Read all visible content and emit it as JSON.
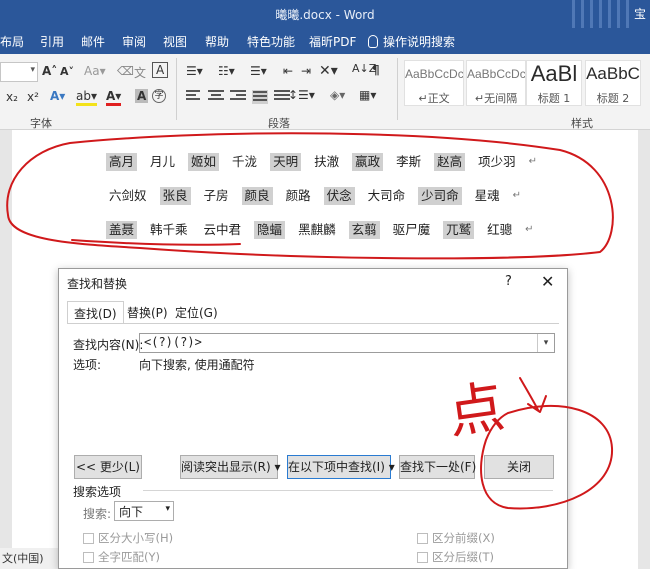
{
  "window": {
    "title": "曦曦.docx - Word",
    "right_text": "宝"
  },
  "tabs": [
    "布局",
    "引用",
    "邮件",
    "审阅",
    "视图",
    "帮助",
    "特色功能",
    "福昕PDF",
    "操作说明搜索"
  ],
  "ribbon": {
    "groups": {
      "font": "字体",
      "paragraph": "段落",
      "styles": "样式"
    },
    "styles": [
      {
        "sample": "AaBbCcDc",
        "name": "正文"
      },
      {
        "sample": "AaBbCcDc",
        "name": "无间隔"
      },
      {
        "sample": "AaBl",
        "name": "标题 1"
      },
      {
        "sample": "AaBbC",
        "name": "标题 2"
      }
    ]
  },
  "document": {
    "lines": [
      [
        "高月",
        "月儿",
        "姬如",
        "千泷",
        "天明",
        "扶澈",
        "嬴政",
        "李斯",
        "赵高",
        "项少羽"
      ],
      [
        "六剑奴",
        "张良",
        "子房",
        "颜良",
        "颜路",
        "伏念",
        "大司命",
        "少司命",
        "星魂"
      ],
      [
        "盖聂",
        "韩千乘",
        "云中君",
        "隐蝠",
        "黑麒麟",
        "玄翦",
        "驱尸魔",
        "兀鹫",
        "红骢"
      ]
    ]
  },
  "dialog": {
    "title": "查找和替换",
    "help": "?",
    "close": "✕",
    "tabs": [
      "查找(D)",
      "替换(P)",
      "定位(G)"
    ],
    "find_label": "查找内容(N):",
    "find_value": "<(?)(?)>",
    "options_label": "选项:",
    "options_value": "向下搜索, 使用通配符",
    "buttons": {
      "less": "<< 更少(L)",
      "highlight": "阅读突出显示(R) ▾",
      "find_in": "在以下项中查找(I) ▾",
      "find_next": "查找下一处(F)",
      "close": "关闭"
    },
    "search_options_title": "搜索选项",
    "search_label": "搜索:",
    "search_value": "向下",
    "checks": [
      "区分大小写(H)",
      "全字匹配(Y)",
      "区分前缀(X)",
      "区分后缀(T)"
    ]
  },
  "status": {
    "language": "文(中国)"
  },
  "annotation": {
    "handwritten": "点"
  },
  "colors": {
    "accent": "#2b579a",
    "annotation": "#d0191b",
    "highlight": "#d0d0d0"
  }
}
